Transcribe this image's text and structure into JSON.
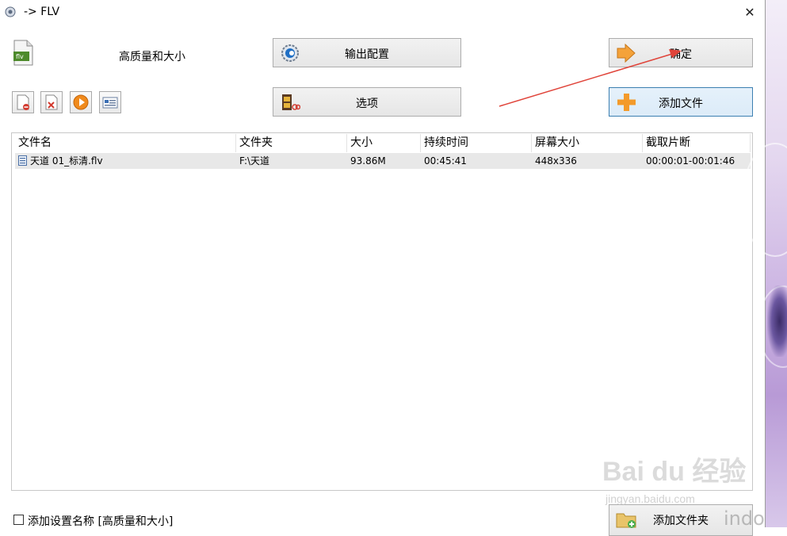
{
  "window": {
    "title": "-> FLV",
    "close_glyph": "✕"
  },
  "profile": {
    "name": "高质量和大小",
    "icon": "flv-file-icon"
  },
  "buttons": {
    "output_config": "输出配置",
    "options": "选项",
    "ok": "确定",
    "add_file": "添加文件",
    "add_folder": "添加文件夹"
  },
  "toolbar": [
    {
      "name": "remove-icon"
    },
    {
      "name": "delete-icon"
    },
    {
      "name": "play-icon"
    },
    {
      "name": "info-icon"
    }
  ],
  "table": {
    "columns": [
      "文件名",
      "文件夹",
      "大小",
      "持续时间",
      "屏幕大小",
      "截取片断"
    ],
    "rows": [
      {
        "name": "天道 01_标清.flv",
        "folder": "F:\\天道",
        "size": "93.86M",
        "duration": "00:45:41",
        "screen": "448x336",
        "clip": "00:00:01-00:01:46"
      }
    ]
  },
  "footer": {
    "checkbox_label": "添加设置名称 [高质量和大小]",
    "checked": false
  },
  "watermark": {
    "brand": "Bai du 经验",
    "site": "jingyan.baidu.com",
    "os_text": "indows"
  },
  "colors": {
    "arrow": "#e0443a",
    "accent_border": "#3c7fb1"
  }
}
